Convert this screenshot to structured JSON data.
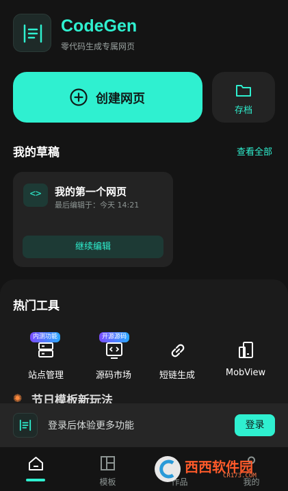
{
  "header": {
    "app_name": "CodeGen",
    "tagline": "零代码生成专属网页",
    "logo_icon": "list-doc-icon"
  },
  "actions": {
    "create_label": "创建网页",
    "create_icon": "plus-circle-icon",
    "archive_label": "存档",
    "archive_icon": "folder-icon"
  },
  "drafts": {
    "title": "我的草稿",
    "view_all": "查看全部",
    "items": [
      {
        "icon_glyph": "<>",
        "name": "我的第一个网页",
        "edited": "最后编辑于：今天 14:21",
        "continue_label": "继续编辑"
      }
    ]
  },
  "hot_tools": {
    "title": "热门工具",
    "items": [
      {
        "label": "站点管理",
        "badge": "内测功能",
        "icon": "server-icon"
      },
      {
        "label": "源码市场",
        "badge": "开源源码",
        "icon": "code-window-icon"
      },
      {
        "label": "短链生成",
        "badge": "",
        "icon": "link-icon"
      },
      {
        "label": "MobView",
        "badge": "",
        "icon": "mobile-view-icon"
      }
    ]
  },
  "festival": {
    "title": "节日模板新玩法"
  },
  "login_banner": {
    "text": "登录后体验更多功能",
    "button": "登录"
  },
  "bottom_nav": {
    "items": [
      {
        "label": "",
        "icon": "home-icon",
        "active": true
      },
      {
        "label": "模板",
        "icon": "template-icon",
        "active": false
      },
      {
        "label": "作品",
        "icon": "works-icon",
        "active": false
      },
      {
        "label": "我的",
        "icon": "profile-icon",
        "active": false
      }
    ]
  },
  "watermark": {
    "text": "西西软件园",
    "sub": "CR173.COM"
  },
  "colors": {
    "accent": "#2ff0d0",
    "background": "#141414",
    "card": "#232323"
  }
}
